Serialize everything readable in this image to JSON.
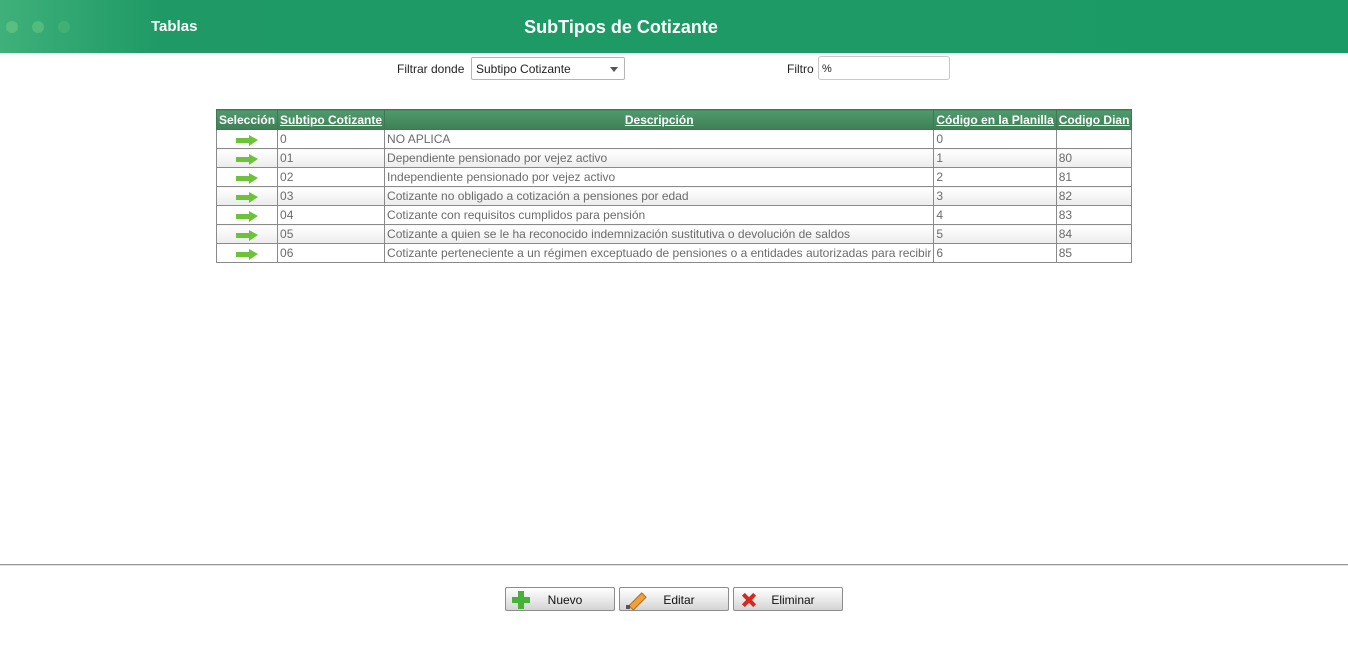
{
  "header": {
    "nav_title": "Tablas",
    "page_title": "SubTipos de Cotizante",
    "background_color": "#1f9a66"
  },
  "filter": {
    "label": "Filtrar donde",
    "selected_field": "Subtipo Cotizante",
    "filtro_label": "Filtro",
    "filtro_value": "%"
  },
  "table": {
    "columns": [
      "Selección",
      "Subtipo Cotizante",
      "Descripción",
      "Código en la Planilla",
      "Codigo Dian"
    ],
    "rows": [
      {
        "subtipo": "0",
        "descripcion": "NO APLICA",
        "codigo_planilla": "0",
        "codigo_dian": ""
      },
      {
        "subtipo": "01",
        "descripcion": "Dependiente pensionado por vejez activo",
        "codigo_planilla": "1",
        "codigo_dian": "80"
      },
      {
        "subtipo": "02",
        "descripcion": "Independiente pensionado por vejez activo",
        "codigo_planilla": "2",
        "codigo_dian": "81"
      },
      {
        "subtipo": "03",
        "descripcion": "Cotizante no obligado a cotización a pensiones por edad",
        "codigo_planilla": "3",
        "codigo_dian": "82"
      },
      {
        "subtipo": "04",
        "descripcion": "Cotizante con requisitos cumplidos para pensión",
        "codigo_planilla": "4",
        "codigo_dian": "83"
      },
      {
        "subtipo": "05",
        "descripcion": "Cotizante a quien se le ha reconocido indemnización sustitutiva o devolución de saldos",
        "codigo_planilla": "5",
        "codigo_dian": "84"
      },
      {
        "subtipo": "06",
        "descripcion": "Cotizante perteneciente a un régimen exceptuado de pensiones o a entidades autorizadas para recibir",
        "codigo_planilla": "6",
        "codigo_dian": "85"
      }
    ]
  },
  "buttons": {
    "nuevo": "Nuevo",
    "editar": "Editar",
    "eliminar": "Eliminar"
  }
}
